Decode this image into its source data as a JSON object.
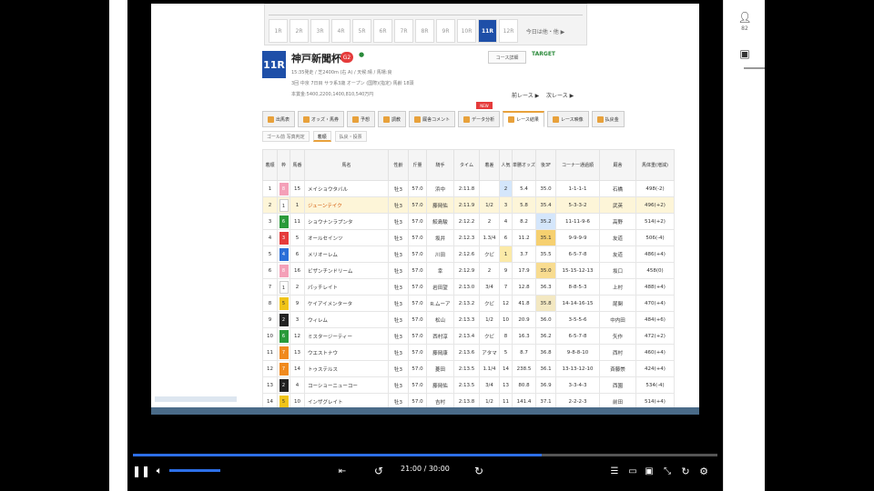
{
  "race_nav": {
    "tabs": [
      "1R",
      "2R",
      "3R",
      "4R",
      "5R",
      "6R",
      "7R",
      "8R",
      "9R",
      "10R",
      "11R",
      "12R"
    ],
    "active_index": 10,
    "more_label": "今日は他・他 ▶"
  },
  "race": {
    "number": "11R",
    "title": "神戸新聞杯",
    "grade": "G2",
    "info_line1": "15:35発走 / 芝2400m (右 A) / 天候:晴 / 馬場:良",
    "info_line2": "3回 中京 7日目 サラ系3歳 オープン (国際)(指定) 馬齢 18頭",
    "info_line3": "本賞金:5400,2200,1400,810,540万円",
    "course_button": "コース詳細",
    "brand": "TARGET",
    "prev_label": "前レース ▶",
    "next_label": "次レース ▶"
  },
  "tabs": {
    "items": [
      "出馬表",
      "オッズ・馬券",
      "予想",
      "調教",
      "厩舎コメント",
      "データ分析",
      "レース結果",
      "レース映像",
      "払戻金"
    ],
    "active_index": 6,
    "new_badge": "NEW"
  },
  "subtabs": {
    "items": [
      "ゴール前 写真判定",
      "着順",
      "払戻・投票"
    ],
    "active_index": 1
  },
  "table": {
    "headers": [
      "着順",
      "枠",
      "馬番",
      "馬名",
      "性齢",
      "斤量",
      "騎手",
      "タイム",
      "着差",
      "人気",
      "単勝オッズ",
      "後3F",
      "コーナー通過順",
      "厩舎",
      "馬体重(増減)"
    ],
    "rows": [
      {
        "rank": "1",
        "waku": "8",
        "umaban": "15",
        "name": "メイショウタバル",
        "sei": "牡3",
        "kin": "57.0",
        "jockey": "浜中",
        "time": "2:11.8",
        "margin": "",
        "pop": "2",
        "odds": "5.4",
        "last3f": "35.0",
        "corner": "1-1-1-1",
        "stable": "石橋",
        "weight": "498(-2)"
      },
      {
        "rank": "2",
        "waku": "1",
        "umaban": "1",
        "name": "ジューンテイク",
        "sei": "牡3",
        "kin": "57.0",
        "jockey": "藤岡佑",
        "time": "2:11.9",
        "margin": "1/2",
        "pop": "3",
        "odds": "5.8",
        "last3f": "35.4",
        "corner": "5-3-3-2",
        "stable": "武英",
        "weight": "496(+2)"
      },
      {
        "rank": "3",
        "waku": "6",
        "umaban": "11",
        "name": "ショウナンラプンタ",
        "sei": "牡3",
        "kin": "57.0",
        "jockey": "鮫島駿",
        "time": "2:12.2",
        "margin": "2",
        "pop": "4",
        "odds": "8.2",
        "last3f": "35.2",
        "corner": "11-11-9-6",
        "stable": "高野",
        "weight": "514(+2)"
      },
      {
        "rank": "4",
        "waku": "3",
        "umaban": "5",
        "name": "オールセインツ",
        "sei": "牡3",
        "kin": "57.0",
        "jockey": "坂井",
        "time": "2:12.3",
        "margin": "1.3/4",
        "pop": "6",
        "odds": "11.2",
        "last3f": "35.1",
        "corner": "9-9-9-9",
        "stable": "友道",
        "weight": "506(-4)"
      },
      {
        "rank": "5",
        "waku": "4",
        "umaban": "6",
        "name": "メリオーレム",
        "sei": "牡3",
        "kin": "57.0",
        "jockey": "川田",
        "time": "2:12.6",
        "margin": "クビ",
        "pop": "1",
        "odds": "3.7",
        "last3f": "35.5",
        "corner": "6-5-7-8",
        "stable": "友道",
        "weight": "486(+4)"
      },
      {
        "rank": "6",
        "waku": "8",
        "umaban": "16",
        "name": "ビザンチンドリーム",
        "sei": "牡3",
        "kin": "57.0",
        "jockey": "幸",
        "time": "2:12.9",
        "margin": "2",
        "pop": "9",
        "odds": "17.9",
        "last3f": "35.0",
        "corner": "15-15-12-13",
        "stable": "坂口",
        "weight": "458(0)"
      },
      {
        "rank": "7",
        "waku": "1",
        "umaban": "2",
        "name": "パッチレイト",
        "sei": "牡3",
        "kin": "57.0",
        "jockey": "岩田望",
        "time": "2:13.0",
        "margin": "3/4",
        "pop": "7",
        "odds": "12.8",
        "last3f": "36.3",
        "corner": "8-8-5-3",
        "stable": "上村",
        "weight": "488(+4)"
      },
      {
        "rank": "8",
        "waku": "5",
        "umaban": "9",
        "name": "ケイアイメンタータ",
        "sei": "牡3",
        "kin": "57.0",
        "jockey": "R.ムーア",
        "time": "2:13.2",
        "margin": "クビ",
        "pop": "12",
        "odds": "41.8",
        "last3f": "35.8",
        "corner": "14-14-16-15",
        "stable": "尾関",
        "weight": "470(+4)"
      },
      {
        "rank": "9",
        "waku": "2",
        "umaban": "3",
        "name": "ウィレム",
        "sei": "牡3",
        "kin": "57.0",
        "jockey": "松山",
        "time": "2:13.3",
        "margin": "1/2",
        "pop": "10",
        "odds": "20.9",
        "last3f": "36.0",
        "corner": "3-5-5-6",
        "stable": "中内田",
        "weight": "484(+6)"
      },
      {
        "rank": "10",
        "waku": "6",
        "umaban": "12",
        "name": "ミスタージーティー",
        "sei": "牡3",
        "kin": "57.0",
        "jockey": "西村淳",
        "time": "2:13.4",
        "margin": "クビ",
        "pop": "8",
        "odds": "16.3",
        "last3f": "36.2",
        "corner": "6-5-7-8",
        "stable": "矢作",
        "weight": "472(+2)"
      },
      {
        "rank": "11",
        "waku": "7",
        "umaban": "13",
        "name": "ウエストナウ",
        "sei": "牡3",
        "kin": "57.0",
        "jockey": "藤岡康",
        "time": "2:13.6",
        "margin": "アタマ",
        "pop": "5",
        "odds": "8.7",
        "last3f": "36.8",
        "corner": "9-8-8-10",
        "stable": "西村",
        "weight": "460(+4)"
      },
      {
        "rank": "12",
        "waku": "7",
        "umaban": "14",
        "name": "トゥステルス",
        "sei": "牡3",
        "kin": "57.0",
        "jockey": "菱田",
        "time": "2:13.5",
        "margin": "1.1/4",
        "pop": "14",
        "odds": "238.5",
        "last3f": "36.1",
        "corner": "13-13-12-10",
        "stable": "斉藤崇",
        "weight": "424(+4)"
      },
      {
        "rank": "13",
        "waku": "2",
        "umaban": "4",
        "name": "コーショーニューコー",
        "sei": "牡3",
        "kin": "57.0",
        "jockey": "藤岡佑",
        "time": "2:13.5",
        "margin": "3/4",
        "pop": "13",
        "odds": "80.8",
        "last3f": "36.9",
        "corner": "3-3-4-3",
        "stable": "西園",
        "weight": "534(-4)"
      },
      {
        "rank": "14",
        "waku": "5",
        "umaban": "10",
        "name": "インザグレイト",
        "sei": "牡3",
        "kin": "57.0",
        "jockey": "吉村",
        "time": "2:13.8",
        "margin": "1/2",
        "pop": "11",
        "odds": "141.4",
        "last3f": "37.1",
        "corner": "2-2-2-3",
        "stable": "前田",
        "weight": "514(+4)"
      }
    ]
  },
  "player": {
    "time_current": "21:00",
    "time_total": "30:00",
    "progress": 0.7,
    "volume": 0.6
  },
  "side": {
    "count": "82"
  },
  "colors": {
    "accent": "#2d6fe8",
    "race_number_bg": "#1e4fa8",
    "highlight_row": "#fdf5d8",
    "waku": {
      "1": "#ffffff",
      "2": "#222222",
      "3": "#e53b3b",
      "4": "#2a6fd8",
      "5": "#f0c419",
      "6": "#2a9a3a",
      "7": "#f08a1e",
      "8": "#f4a0b8"
    }
  }
}
